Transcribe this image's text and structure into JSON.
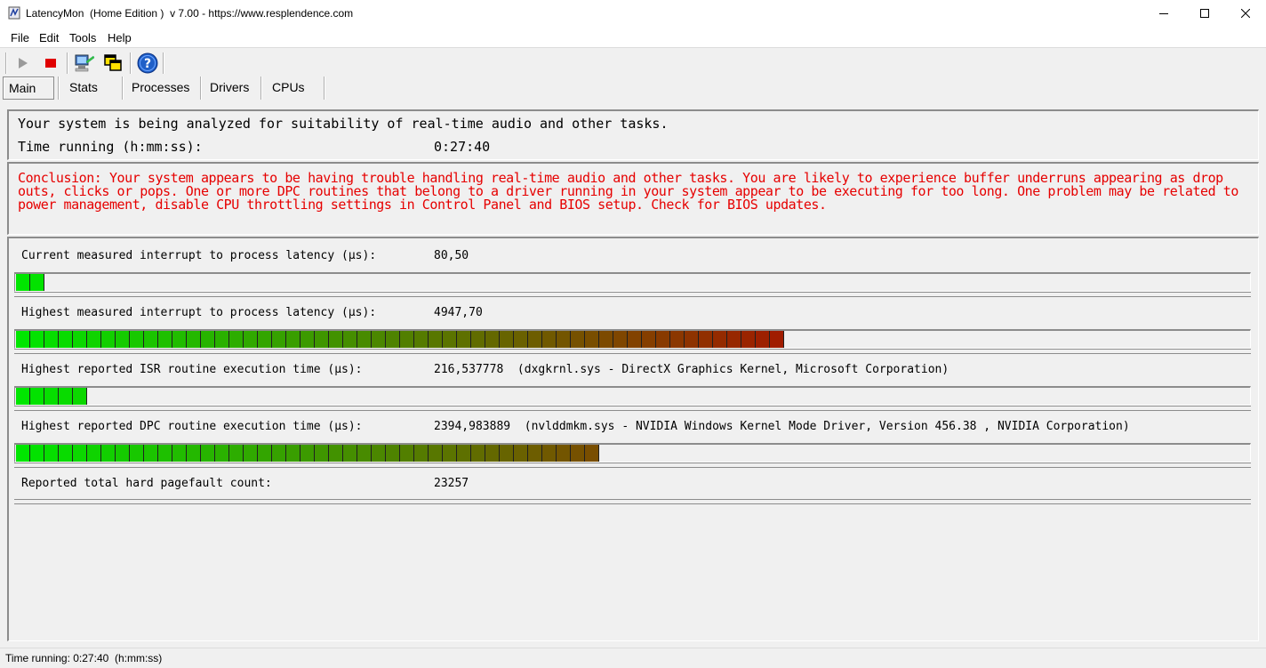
{
  "window": {
    "title": "LatencyMon  (Home Edition )  v 7.00 - https://www.resplendence.com",
    "icon": "latencymon-app-icon"
  },
  "menu": [
    "File",
    "Edit",
    "Tools",
    "Help"
  ],
  "toolbar": {
    "buttons": [
      "play-icon",
      "stop-icon",
      "computer-report-icon",
      "copy-windows-icon",
      "help-icon"
    ]
  },
  "tabs": [
    "Main",
    "Stats",
    "Processes",
    "Drivers",
    "CPUs"
  ],
  "active_tab": "Main",
  "status": {
    "analyzing": "Your system is being analyzed for suitability of real-time audio and other tasks.",
    "time_label": "Time running (h:mm:ss):",
    "time_value": "0:27:40"
  },
  "conclusion": "Conclusion: Your system appears to be having trouble handling real-time audio and other tasks. You are likely to experience buffer underruns appearing as drop outs, clicks or pops. One or more DPC routines that belong to a driver running in your system appear to be executing for too long. One problem may be related to power management, disable CPU throttling settings in Control Panel and BIOS setup. Check for BIOS updates.",
  "metrics": [
    {
      "label": "Current measured interrupt to process latency (µs):",
      "value": "80,50",
      "bar_segments": 2
    },
    {
      "label": "Highest measured interrupt to process latency (µs):",
      "value": "4947,70",
      "bar_segments": 54
    },
    {
      "label": "Highest reported ISR routine execution time (µs):",
      "value": "216,537778  (dxgkrnl.sys - DirectX Graphics Kernel, Microsoft Corporation)",
      "bar_segments": 5
    },
    {
      "label": "Highest reported DPC routine execution time (µs):",
      "value": "2394,983889  (nvlddmkm.sys - NVIDIA Windows Kernel Mode Driver, Version 456.38 , NVIDIA Corporation)",
      "bar_segments": 41
    },
    {
      "label": "Reported total hard pagefault count:",
      "value": "23257",
      "bar_segments": 0
    }
  ],
  "statusbar": "Time running: 0:27:40  (h:mm:ss)",
  "colors": {
    "conclusion_text": "#e60000",
    "bar_start": "#00e600",
    "bar_end": "#a01c00"
  }
}
